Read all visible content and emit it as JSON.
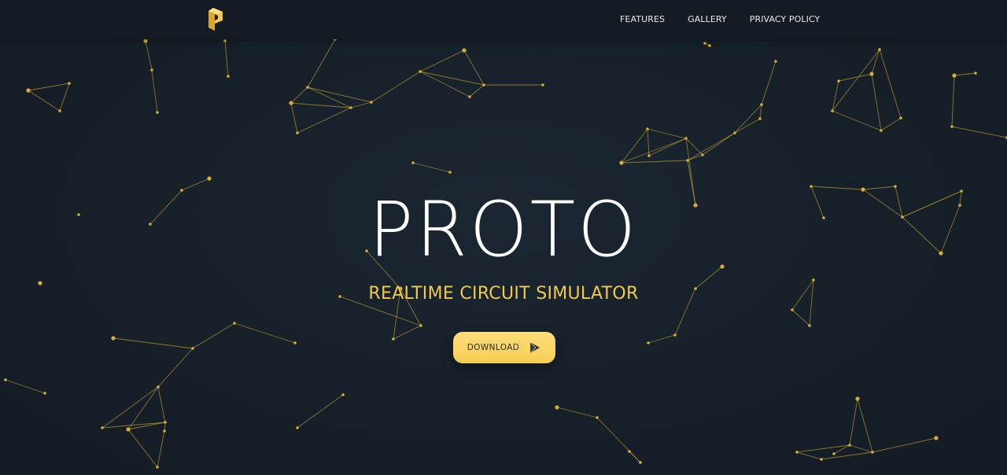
{
  "nav": {
    "logo_icon": "proto-p-logo-icon",
    "links": [
      {
        "label": "FEATURES"
      },
      {
        "label": "GALLERY"
      },
      {
        "label": "PRIVACY POLICY"
      }
    ]
  },
  "hero": {
    "title": "PROTO",
    "subtitle": "REALTIME CIRCUIT SIMULATOR",
    "download_label": "DOWNLOAD",
    "download_icon": "google-play-icon"
  },
  "colors": {
    "background": "#17202a",
    "navbar": "#151b22",
    "accent": "#f2c94c",
    "node": "#d8ad3a",
    "line": "#b8942f",
    "title": "#ffffff"
  }
}
